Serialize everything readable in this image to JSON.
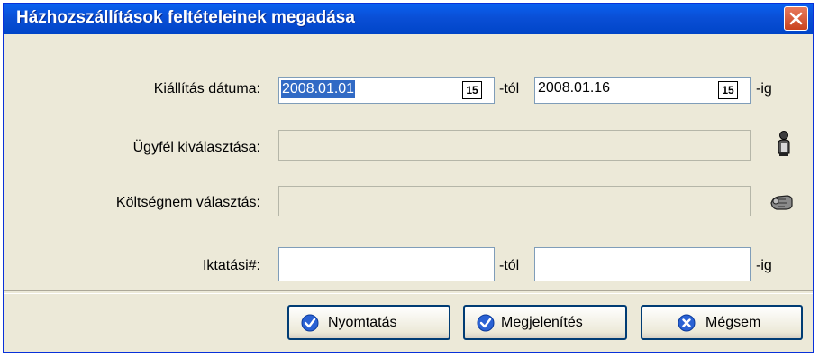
{
  "dialog": {
    "title": "Házhozszállítások feltételeinek megadása"
  },
  "fields": {
    "issue_date_label": "Kiállítás dátuma:",
    "issue_date_from": "2008.01.01",
    "issue_date_to": "2008.01.16",
    "from_suffix": "-tól",
    "to_suffix": "-ig",
    "calendar_icon_text": "15",
    "client_label": "Ügyfél kiválasztása:",
    "cost_center_label": "Költségnem választás:",
    "filing_label": "Iktatási#:",
    "filing_from": "",
    "filing_to": ""
  },
  "buttons": {
    "print": "Nyomtatás",
    "display": "Megjelenítés",
    "cancel": "Mégsem"
  },
  "icons": {
    "close": "close-icon",
    "calendar": "calendar-icon",
    "client_picker": "person-picker-icon",
    "cost_center_picker": "hand-picker-icon",
    "ok": "checkmark-icon",
    "cancel": "x-icon"
  },
  "colors": {
    "titlebar": "#0a4fd6",
    "dialog_bg": "#ece9d8",
    "close_button": "#d9542f",
    "selection": "#316ac5",
    "button_icon": "#2a62d4"
  }
}
